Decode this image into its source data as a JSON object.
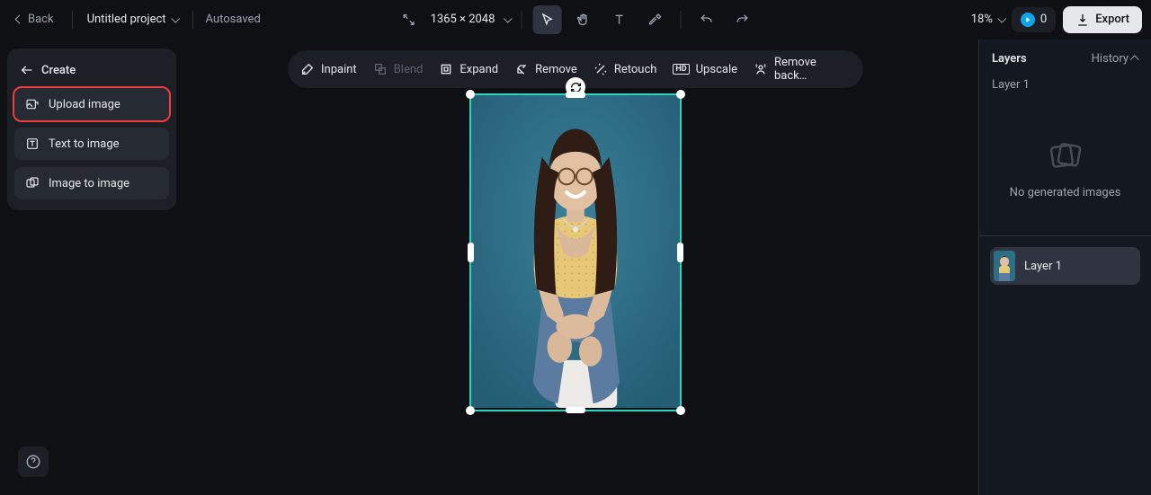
{
  "topbar": {
    "back_label": "Back",
    "project_name": "Untitled project",
    "autosaved_label": "Autosaved",
    "dimensions": "1365 × 2048",
    "zoom": "18%",
    "credits": "0",
    "export_label": "Export"
  },
  "left_panel": {
    "create_label": "Create",
    "upload_label": "Upload image",
    "text_to_image_label": "Text to image",
    "image_to_image_label": "Image to image"
  },
  "tools": {
    "inpaint": "Inpaint",
    "blend": "Blend",
    "expand": "Expand",
    "remove": "Remove",
    "retouch": "Retouch",
    "upscale": "Upscale",
    "remove_bg": "Remove back…"
  },
  "right_panel": {
    "layers_title": "Layers",
    "history_label": "History",
    "selected_layer_name": "Layer 1",
    "empty_state": "No generated images",
    "layer_item_label": "Layer 1"
  }
}
